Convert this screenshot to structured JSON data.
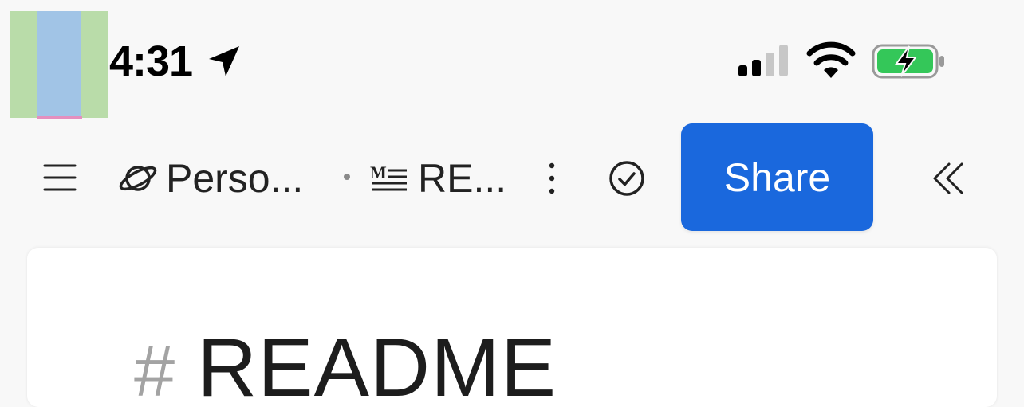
{
  "status_bar": {
    "time": "4:31",
    "icons": [
      "location-arrow-icon",
      "cellular-signal-icon",
      "wifi-icon",
      "battery-charging-icon"
    ],
    "battery_color": "#34c759",
    "signal_bars_active": 2,
    "signal_bars_total": 4
  },
  "toolbar": {
    "menu_icon": "hamburger-menu-icon",
    "workspace": {
      "icon": "planet-icon",
      "label": "Perso..."
    },
    "file": {
      "icon": "markdown-icon",
      "label": "RE..."
    },
    "more_icon": "vertical-ellipsis-icon",
    "check_icon": "check-circle-icon",
    "share_label": "Share",
    "share_color": "#1a68dd",
    "collapse_icon": "double-chevron-left-icon"
  },
  "document": {
    "heading_marker": "#",
    "heading_text": "README"
  }
}
